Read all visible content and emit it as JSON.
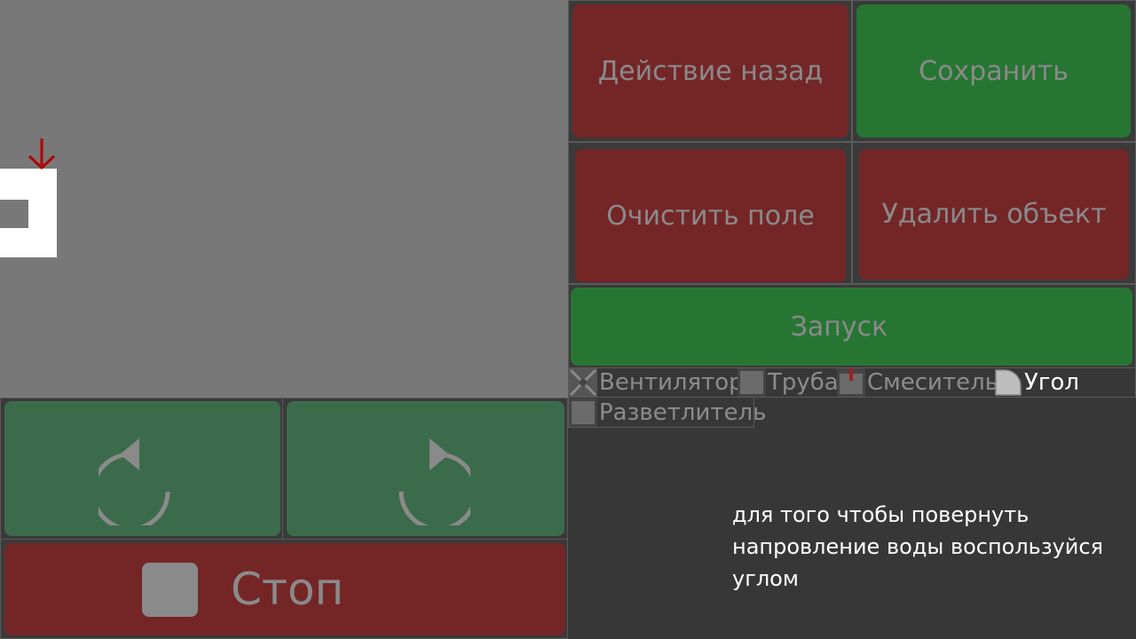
{
  "editor": {
    "undo_label": "Действие назад",
    "save_label": "Сохранить",
    "clear_label": "Очистить поле",
    "delete_label": "Удалить объект",
    "run_label": "Запуск"
  },
  "palette": {
    "items": [
      {
        "label": "Вентилятор",
        "icon": "fan-icon"
      },
      {
        "label": "Труба",
        "icon": "pipe-icon"
      },
      {
        "label": "Смеситель",
        "icon": "mixer-icon"
      },
      {
        "label": "Угол",
        "icon": "corner-icon",
        "selected": true
      },
      {
        "label": "Разветлитель",
        "icon": "splitter-icon"
      }
    ]
  },
  "controls": {
    "rotate_left_icon": "rotate-left-icon",
    "rotate_right_icon": "rotate-right-icon",
    "stop_label": "Стоп"
  },
  "hint": {
    "text": "для того чтобы повернуть напровление воды воспользуйся углом"
  },
  "colors": {
    "danger": "#742627",
    "success": "#277533",
    "rotate": "#3c6b4b",
    "marker": "#b00000"
  }
}
